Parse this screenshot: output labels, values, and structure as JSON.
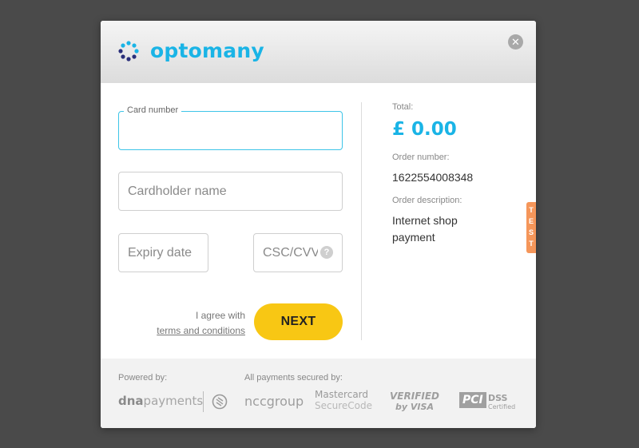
{
  "header": {
    "brand": "optomany",
    "brand_color": "#1ab4e6"
  },
  "form": {
    "card_number_label": "Card number",
    "cardholder_placeholder": "Cardholder name",
    "expiry_placeholder": "Expiry date",
    "cvv_placeholder": "CSC/CVV",
    "agree_text": "I agree with",
    "terms_link": "terms and conditions",
    "next_label": "NEXT",
    "next_color": "#f8c714"
  },
  "summary": {
    "total_label": "Total:",
    "total_value": "£ 0.00",
    "order_number_label": "Order number:",
    "order_number": "1622554008348",
    "order_description_label": "Order description:",
    "order_description": "Internet shop payment"
  },
  "test_badge": "TEST",
  "footer": {
    "powered_by_label": "Powered by:",
    "secured_by_label": "All payments secured by:",
    "logos": {
      "dna_bold": "dna",
      "dna_rest": "payments",
      "ncc": "nccgroup",
      "mastercard_line1": "Mastercard",
      "mastercard_line2": "SecureCode",
      "verified_line1": "VERIFIED",
      "verified_line2": "by VISA",
      "pci_line1": "PCI",
      "pci_line2": "DSS",
      "pci_line3": "Certified"
    }
  }
}
